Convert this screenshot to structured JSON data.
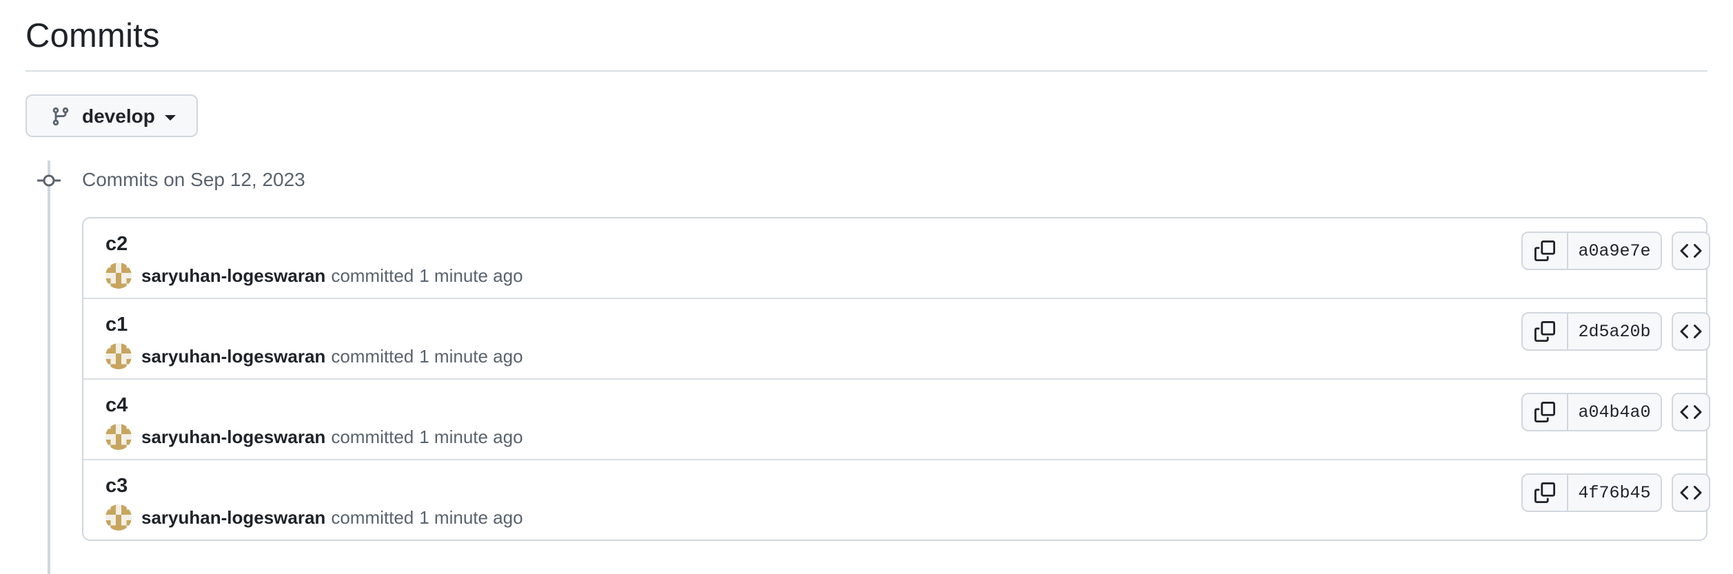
{
  "page": {
    "title": "Commits"
  },
  "branch_selector": {
    "label": "develop",
    "icon": "git-branch-icon",
    "caret_icon": "triangle-down-icon"
  },
  "timeline": {
    "node_icon": "git-commit-icon",
    "group_heading": "Commits on Sep 12, 2023"
  },
  "commits": [
    {
      "message": "c2",
      "author": "saryuhan-logeswaran",
      "committed_word": "committed",
      "time": "1 minute ago",
      "sha": "a0a9e7e",
      "copy_icon": "copy-icon",
      "browse_icon": "code-icon"
    },
    {
      "message": "c1",
      "author": "saryuhan-logeswaran",
      "committed_word": "committed",
      "time": "1 minute ago",
      "sha": "2d5a20b",
      "copy_icon": "copy-icon",
      "browse_icon": "code-icon"
    },
    {
      "message": "c4",
      "author": "saryuhan-logeswaran",
      "committed_word": "committed",
      "time": "1 minute ago",
      "sha": "a04b4a0",
      "copy_icon": "copy-icon",
      "browse_icon": "code-icon"
    },
    {
      "message": "c3",
      "author": "saryuhan-logeswaran",
      "committed_word": "committed",
      "time": "1 minute ago",
      "sha": "4f76b45",
      "copy_icon": "copy-icon",
      "browse_icon": "code-icon"
    }
  ],
  "colors": {
    "text_primary": "#1f2328",
    "text_muted": "#59636e",
    "border": "#d0d7de",
    "button_bg": "#f6f8fa",
    "avatar_tan": "#c7a55f",
    "avatar_light": "#f2efe6"
  }
}
